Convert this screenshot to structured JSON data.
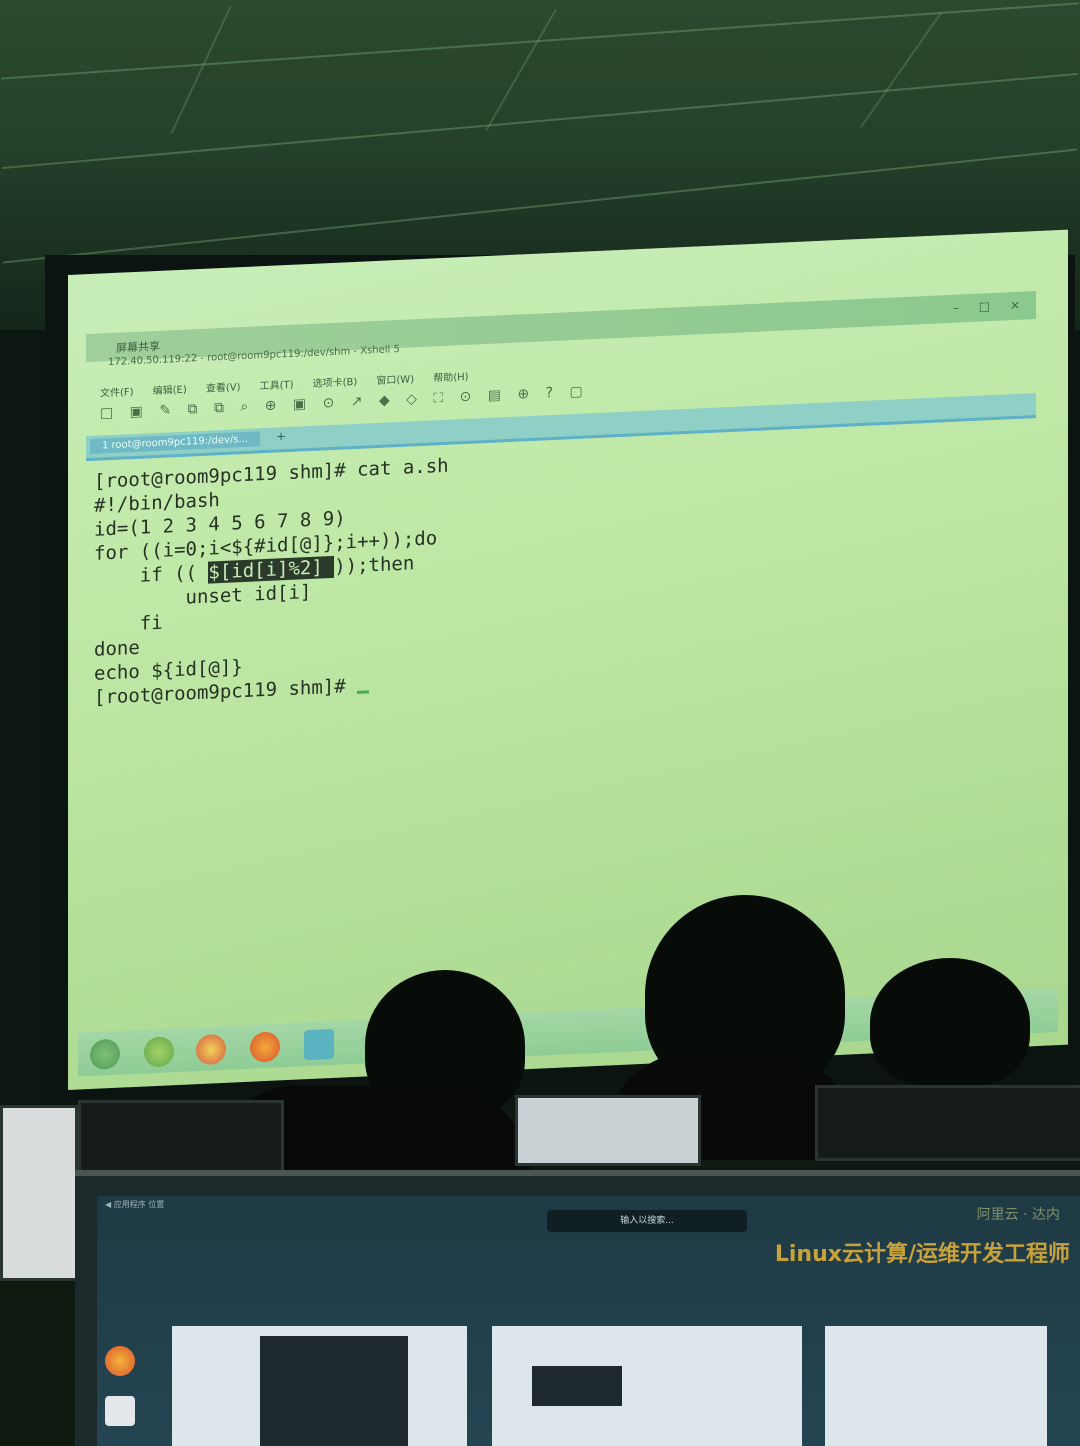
{
  "projected_window": {
    "app_title": "屏幕共享",
    "address": "172.40.50.119:22 - root@room9pc119:/dev/shm - Xshell 5",
    "window_controls": [
      "–",
      "□",
      "×"
    ],
    "menu": [
      "文件(F)",
      "编辑(E)",
      "查看(V)",
      "工具(T)",
      "选项卡(B)",
      "窗口(W)",
      "帮助(H)"
    ],
    "toolbar_glyphs": "□ ▣ ✎  ⧉ ⧉ ⌕  ⊕ ▣ ⊙ ↗  ◆ ◇ ⛶ ⊙ ▤ ⊕  ? ▢",
    "tab_label": "1 root@room9pc119:/dev/s...",
    "tab_add": "+"
  },
  "terminal": {
    "lines": [
      "[root@room9pc119 shm]# cat a.sh",
      "#!/bin/bash",
      "id=(1 2 3 4 5 6 7 8 9)",
      "for ((i=0;i<${#id[@]};i++));do",
      "    if (( ",
      "        unset id[i]",
      "    fi",
      "done",
      "echo ${id[@]}",
      "[root@room9pc119 shm]# "
    ],
    "highlighted": "$[id[i]%2] ",
    "after_highlight": "));then"
  },
  "front_monitor": {
    "search_placeholder": "输入以搜索...",
    "banner_top": "阿里云 · 达内",
    "banner_main": "Linux云计算/运维开发工程师",
    "caption": "◀ 应用程序  位置"
  },
  "colors": {
    "projection_bg": "#c2ebb0",
    "terminal_text": "#253225",
    "tab_accent": "#6fb8c6",
    "banner": "#c9a23a"
  }
}
